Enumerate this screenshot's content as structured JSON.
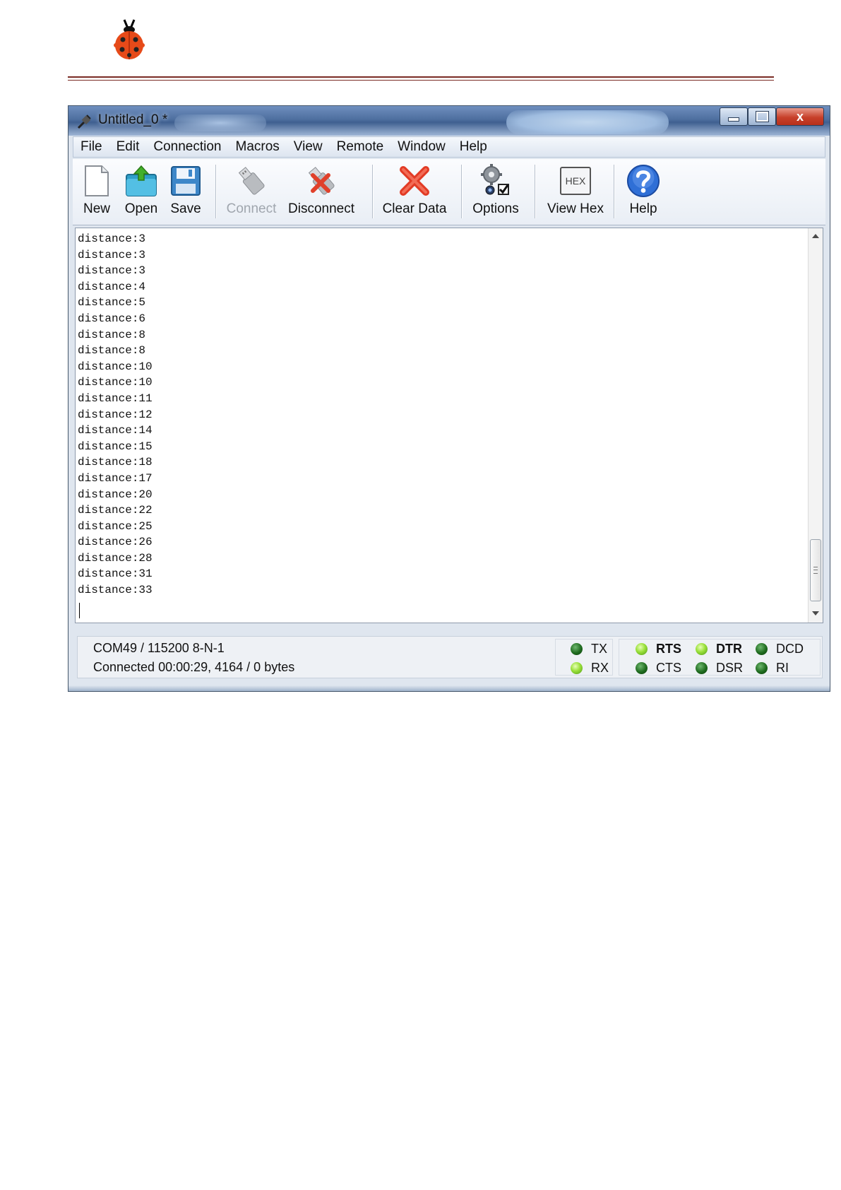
{
  "header": {
    "logo_icon": "ladybug-icon"
  },
  "window": {
    "title": "Untitled_0 *",
    "close_label": "x"
  },
  "menu": {
    "items": [
      {
        "label": "File"
      },
      {
        "label": "Edit"
      },
      {
        "label": "Connection"
      },
      {
        "label": "Macros"
      },
      {
        "label": "View"
      },
      {
        "label": "Remote"
      },
      {
        "label": "Window"
      },
      {
        "label": "Help"
      }
    ]
  },
  "toolbar": {
    "new": "New",
    "open": "Open",
    "save": "Save",
    "connect": "Connect",
    "disconnect": "Disconnect",
    "clear_data": "Clear Data",
    "options": "Options",
    "view_hex": "View Hex",
    "hex_icon_text": "HEX",
    "help": "Help"
  },
  "terminal": {
    "lines": [
      "distance:3",
      "distance:3",
      "distance:3",
      "distance:4",
      "distance:5",
      "distance:6",
      "distance:8",
      "distance:8",
      "distance:10",
      "distance:10",
      "distance:11",
      "distance:12",
      "distance:14",
      "distance:15",
      "distance:18",
      "distance:17",
      "distance:20",
      "distance:22",
      "distance:25",
      "distance:26",
      "distance:28",
      "distance:31",
      "distance:33"
    ]
  },
  "status": {
    "port": "COM49 / 115200 8-N-1",
    "connection": "Connected 00:00:29, 4164 / 0 bytes",
    "signals": {
      "tx": "TX",
      "rx": "RX",
      "rts": "RTS",
      "cts": "CTS",
      "dtr": "DTR",
      "dsr": "DSR",
      "dcd": "DCD",
      "ri": "RI"
    }
  },
  "colors": {
    "led_on": "#9ae03a",
    "led_off": "#1d6a1d",
    "rule": "#7a2b24"
  }
}
